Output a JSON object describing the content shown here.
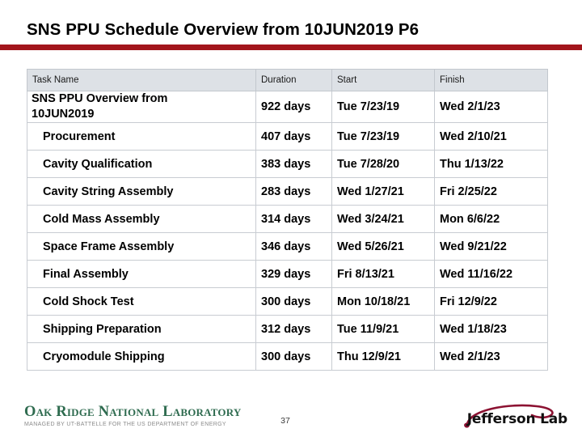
{
  "slide": {
    "title": "SNS PPU Schedule Overview from 10JUN2019 P6",
    "accent_color": "#a2151b",
    "page_number": "37"
  },
  "table": {
    "columns": [
      {
        "key": "task",
        "label": "Task Name"
      },
      {
        "key": "duration",
        "label": "Duration"
      },
      {
        "key": "start",
        "label": "Start"
      },
      {
        "key": "finish",
        "label": "Finish"
      }
    ],
    "header_background": "#dde1e6",
    "rows": [
      {
        "level": 0,
        "task": "SNS PPU Overview from 10JUN2019",
        "duration": "922 days",
        "start": "Tue 7/23/19",
        "finish": "Wed 2/1/23"
      },
      {
        "level": 1,
        "task": "Procurement",
        "duration": "407 days",
        "start": "Tue 7/23/19",
        "finish": "Wed 2/10/21"
      },
      {
        "level": 1,
        "task": "Cavity Qualification",
        "duration": "383 days",
        "start": "Tue 7/28/20",
        "finish": "Thu 1/13/22"
      },
      {
        "level": 1,
        "task": "Cavity String Assembly",
        "duration": "283 days",
        "start": "Wed 1/27/21",
        "finish": "Fri 2/25/22"
      },
      {
        "level": 1,
        "task": "Cold Mass Assembly",
        "duration": "314 days",
        "start": "Wed 3/24/21",
        "finish": "Mon 6/6/22"
      },
      {
        "level": 1,
        "task": "Space Frame Assembly",
        "duration": "346 days",
        "start": "Wed 5/26/21",
        "finish": "Wed 9/21/22"
      },
      {
        "level": 1,
        "task": "Final Assembly",
        "duration": "329 days",
        "start": "Fri 8/13/21",
        "finish": "Wed 11/16/22"
      },
      {
        "level": 1,
        "task": "Cold Shock Test",
        "duration": "300 days",
        "start": "Mon 10/18/21",
        "finish": "Fri 12/9/22"
      },
      {
        "level": 1,
        "task": "Shipping Preparation",
        "duration": "312 days",
        "start": "Tue 11/9/21",
        "finish": "Wed 1/18/23"
      },
      {
        "level": 1,
        "task": "Cryomodule Shipping",
        "duration": "300 days",
        "start": "Thu 12/9/21",
        "finish": "Wed 2/1/23"
      }
    ]
  },
  "footer": {
    "ornl": {
      "name": "Oak Ridge National Laboratory",
      "tagline": "MANAGED BY UT-BATTELLE FOR THE US DEPARTMENT OF ENERGY",
      "color": "#2e6b4f"
    },
    "jlab": {
      "name": "Jefferson Lab",
      "swoosh_color": "#8c1232"
    }
  }
}
